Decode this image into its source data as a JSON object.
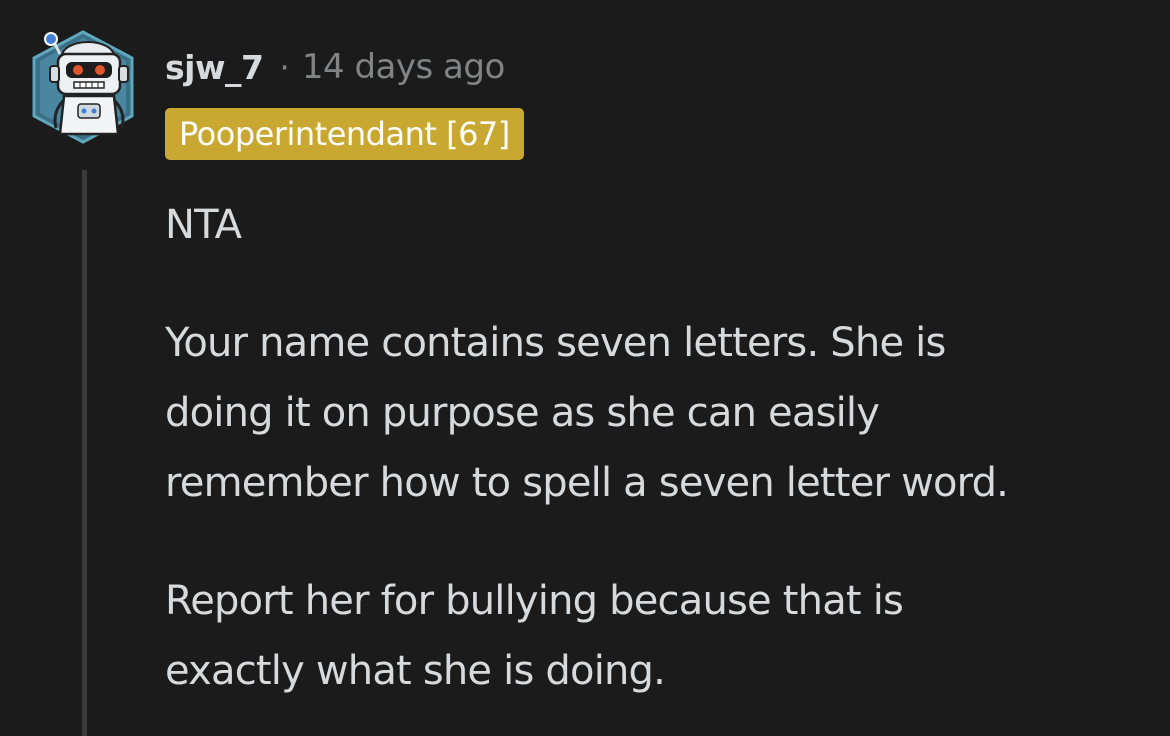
{
  "comment": {
    "username": "sjw_7",
    "separator": "·",
    "timestamp": "14 days ago",
    "flair": "Pooperintendant [67]",
    "paragraphs": {
      "p1": "NTA",
      "p2_lines": [
        "Your name contains seven letters. She is",
        "doing it on purpose as she can easily",
        "remember how to spell a seven letter word."
      ],
      "p3_lines": [
        "Report her for bullying because that is",
        "exactly what she is doing."
      ]
    }
  },
  "colors": {
    "background": "#1b1b1b",
    "text": "#d7dadc",
    "meta": "#818384",
    "flair_bg": "#c9a832",
    "thread_line": "#3a3a3a"
  },
  "icons": {
    "avatar": "robot-avatar-icon"
  }
}
